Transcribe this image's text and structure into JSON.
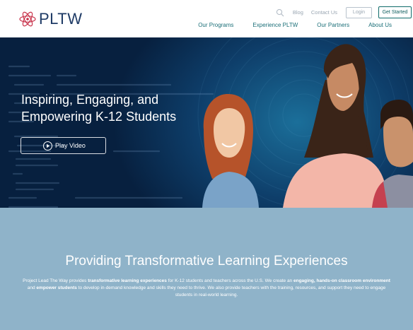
{
  "header": {
    "logo_text": "PLTW",
    "util_links": [
      "Blog",
      "Contact Us"
    ],
    "login_label": "Login",
    "get_started_label": "Get Started",
    "nav": [
      "Our Programs",
      "Experience PLTW",
      "Our Partners",
      "About Us"
    ]
  },
  "hero": {
    "title_line1": "Inspiring, Engaging, and",
    "title_line2": "Empowering K-12 Students",
    "play_label": "Play Video"
  },
  "mission": {
    "title": "Providing Transformative Learning Experiences",
    "body": [
      {
        "text": "Project Lead The Way provides ",
        "bold": false
      },
      {
        "text": "transformative learning experiences",
        "bold": true
      },
      {
        "text": " for K-12 students and teachers across the U.S. We create an ",
        "bold": false
      },
      {
        "text": "engaging, hands-on classroom environment",
        "bold": true
      },
      {
        "text": " and ",
        "bold": false
      },
      {
        "text": "empower students",
        "bold": true
      },
      {
        "text": " to develop in-demand knowledge and skills they need to thrive. We also provide teachers with the training, resources, and support they need to engage students in real-world learning.",
        "bold": false
      }
    ]
  },
  "colors": {
    "brand_navy": "#1f3b66",
    "nav_teal": "#1b6f78",
    "hero_blue": "#0e3e6a",
    "mission_bg": "#8fb3c9"
  },
  "icons": {
    "logo": "atom-logo-icon",
    "search": "search-icon",
    "play": "play-circle-icon"
  }
}
